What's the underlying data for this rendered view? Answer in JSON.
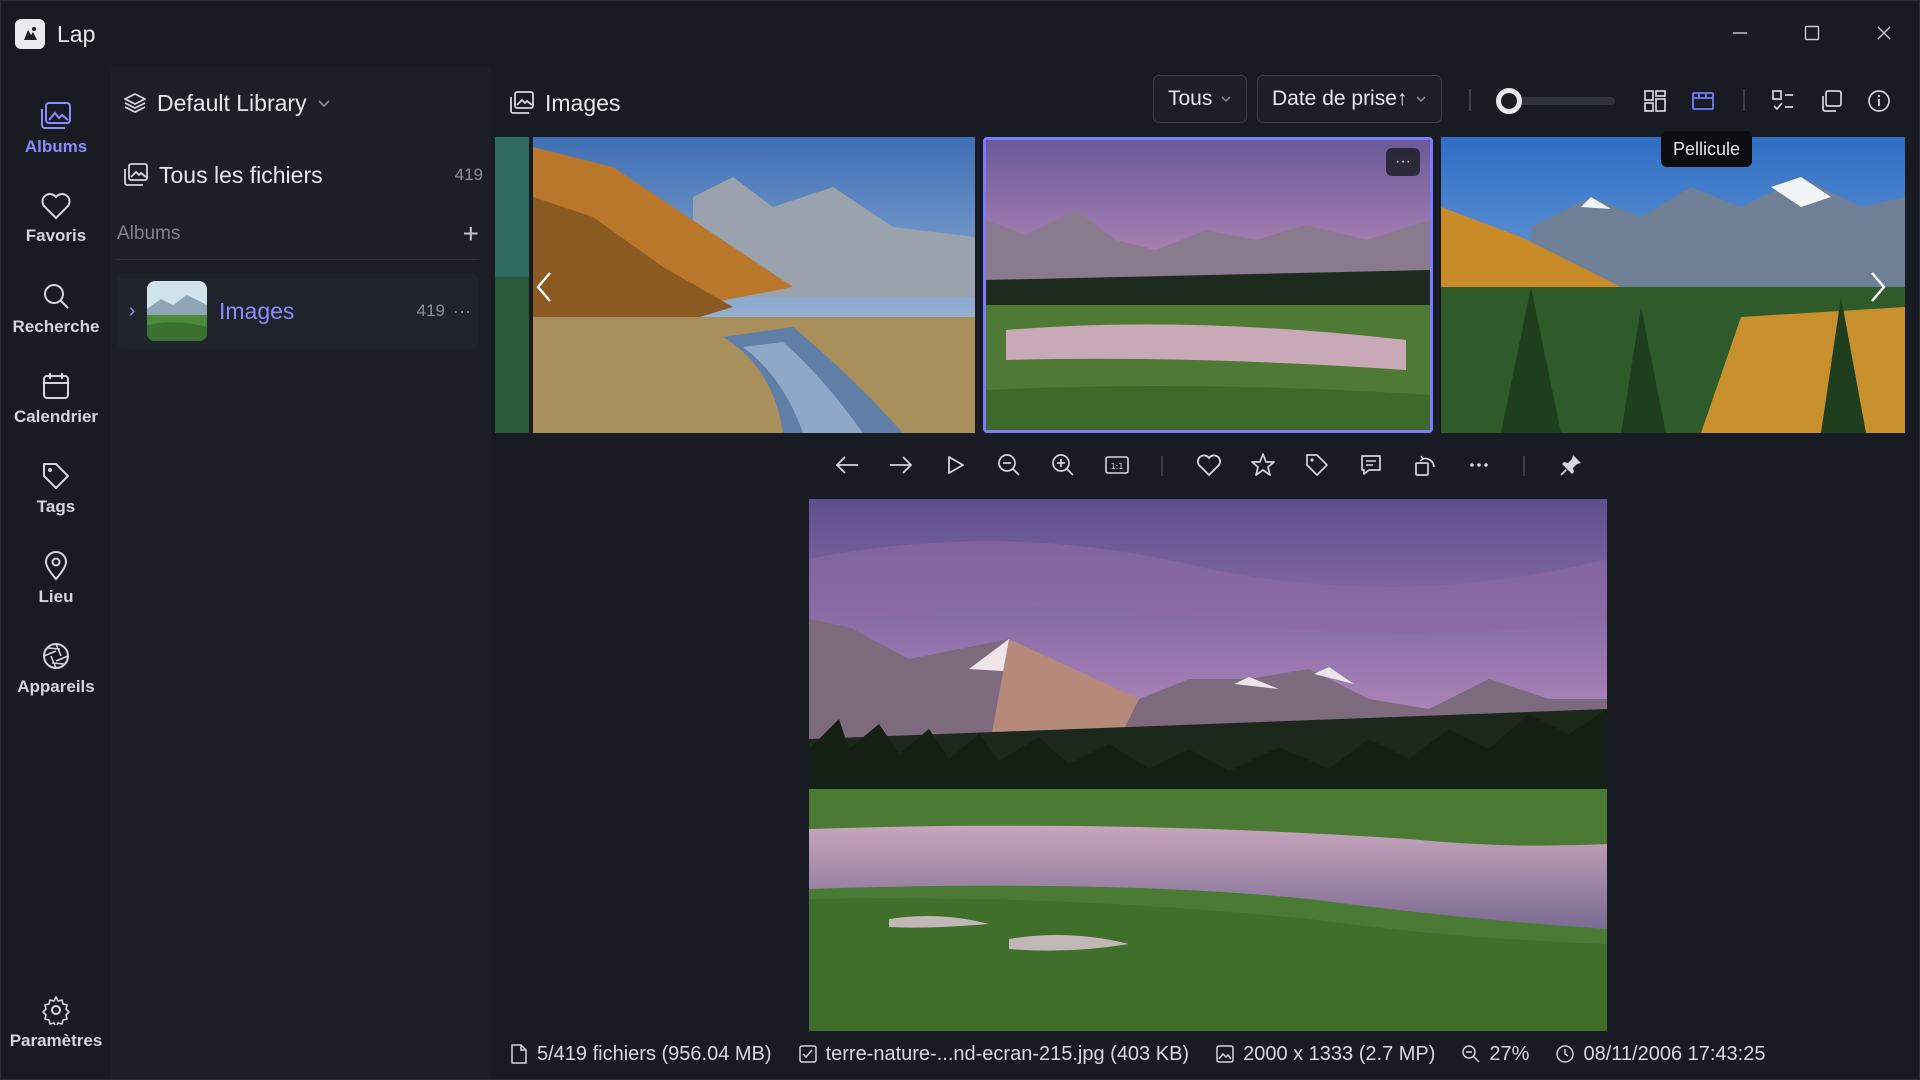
{
  "app": {
    "title": "Lap"
  },
  "window_controls": [
    "minimize-icon",
    "maximize-icon",
    "close-icon"
  ],
  "rail": {
    "items": [
      {
        "label": "Albums",
        "icon": "albums-icon",
        "active": true
      },
      {
        "label": "Favoris",
        "icon": "heart-icon",
        "active": false
      },
      {
        "label": "Recherche",
        "icon": "search-icon",
        "active": false
      },
      {
        "label": "Calendrier",
        "icon": "calendar-icon",
        "active": false
      },
      {
        "label": "Tags",
        "icon": "tag-icon",
        "active": false
      },
      {
        "label": "Lieu",
        "icon": "location-icon",
        "active": false
      },
      {
        "label": "Appareils",
        "icon": "camera-aperture-icon",
        "active": false
      }
    ],
    "settings": {
      "label": "Paramètres",
      "icon": "gear-icon"
    }
  },
  "library": {
    "name": "Default Library",
    "all_files": {
      "label": "Tous les fichiers",
      "count": "419"
    },
    "albums_header": "Albums",
    "albums": [
      {
        "name": "Images",
        "count": "419"
      }
    ]
  },
  "toolbar": {
    "title": "Images",
    "filter": "Tous",
    "sort": "Date de prise↑",
    "tooltip": "Pellicule",
    "view_mode": "filmstrip"
  },
  "filmstrip": {
    "selected_index": 1,
    "more_label": "···"
  },
  "actions": [
    "arrow-left-icon",
    "arrow-right-icon",
    "play-icon",
    "zoom-out-icon",
    "zoom-in-icon",
    "actual-size-icon",
    "heart-icon",
    "star-icon",
    "tag-icon",
    "comment-icon",
    "rotate-icon",
    "more-icon",
    "pin-icon"
  ],
  "status": {
    "files": "5/419 fichiers (956.04 MB)",
    "filename": "terre-nature-...nd-ecran-215.jpg (403 KB)",
    "dimensions": "2000 x 1333 (2.7 MP)",
    "zoom": "27%",
    "date": "08/11/2006 17:43:25"
  },
  "colors": {
    "accent": "#7b7bff",
    "background": "#181b22",
    "panel": "#1c1f26"
  }
}
